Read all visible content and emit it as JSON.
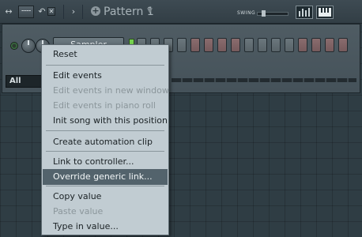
{
  "toolbar": {
    "pattern_name": "Pattern 1",
    "swing_label": "SWING",
    "swing_value": 0.15
  },
  "channel": {
    "name": "Sampler",
    "steps": [
      "gray",
      "gray",
      "gray",
      "gray",
      "red",
      "red",
      "red",
      "red",
      "gray",
      "gray",
      "gray",
      "gray",
      "red",
      "red",
      "red",
      "red"
    ]
  },
  "filter": {
    "label": "All"
  },
  "context_menu": {
    "items": [
      {
        "label": "Reset",
        "enabled": true,
        "highlighted": false
      },
      {
        "label": "Edit events",
        "enabled": true,
        "highlighted": false
      },
      {
        "label": "Edit events in new window",
        "enabled": false,
        "highlighted": false
      },
      {
        "label": "Edit events in piano roll",
        "enabled": false,
        "highlighted": false
      },
      {
        "label": "Init song with this position",
        "enabled": true,
        "highlighted": false
      },
      {
        "label": "Create automation clip",
        "enabled": true,
        "highlighted": false
      },
      {
        "label": "Link to controller...",
        "enabled": true,
        "highlighted": false
      },
      {
        "label": "Override generic link...",
        "enabled": true,
        "highlighted": true
      },
      {
        "label": "Copy value",
        "enabled": true,
        "highlighted": false
      },
      {
        "label": "Paste value",
        "enabled": false,
        "highlighted": false
      },
      {
        "label": "Type in value...",
        "enabled": true,
        "highlighted": false
      }
    ]
  }
}
